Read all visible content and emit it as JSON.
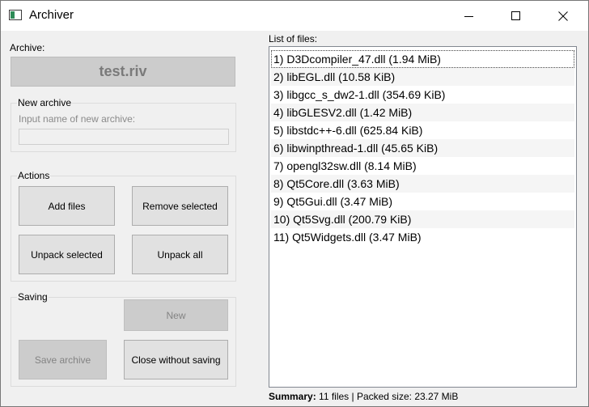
{
  "window": {
    "title": "Archiver"
  },
  "archive": {
    "label": "Archive:",
    "name": "test.riv"
  },
  "new_archive": {
    "group_title": "New archive",
    "input_label": "Input name of new archive:",
    "input_value": ""
  },
  "actions": {
    "group_title": "Actions",
    "add_files": "Add files",
    "remove_selected": "Remove selected",
    "unpack_selected": "Unpack selected",
    "unpack_all": "Unpack all"
  },
  "saving": {
    "group_title": "Saving",
    "new": "New",
    "save_archive": "Save archive",
    "close_without_saving": "Close without saving"
  },
  "files": {
    "label": "List of files:",
    "items": [
      "1) D3Dcompiler_47.dll (1.94 MiB)",
      "2) libEGL.dll (10.58 KiB)",
      "3) libgcc_s_dw2-1.dll (354.69 KiB)",
      "4) libGLESV2.dll (1.42 MiB)",
      "5) libstdc++-6.dll (625.84 KiB)",
      "6) libwinpthread-1.dll (45.65 KiB)",
      "7) opengl32sw.dll (8.14 MiB)",
      "8) Qt5Core.dll (3.63 MiB)",
      "9) Qt5Gui.dll (3.47 MiB)",
      "10) Qt5Svg.dll (200.79 KiB)",
      "11) Qt5Widgets.dll (3.47 MiB)"
    ]
  },
  "summary": {
    "label": "Summary:",
    "text": "11 files | Packed size: 23.27 MiB"
  },
  "icons": {
    "app": "app-window-icon",
    "minimize": "minimize-icon",
    "maximize": "maximize-icon",
    "close": "close-icon"
  },
  "colors": {
    "disabled_button": "#cccccc",
    "button": "#e1e1e1",
    "list_background": "#ffffff"
  }
}
